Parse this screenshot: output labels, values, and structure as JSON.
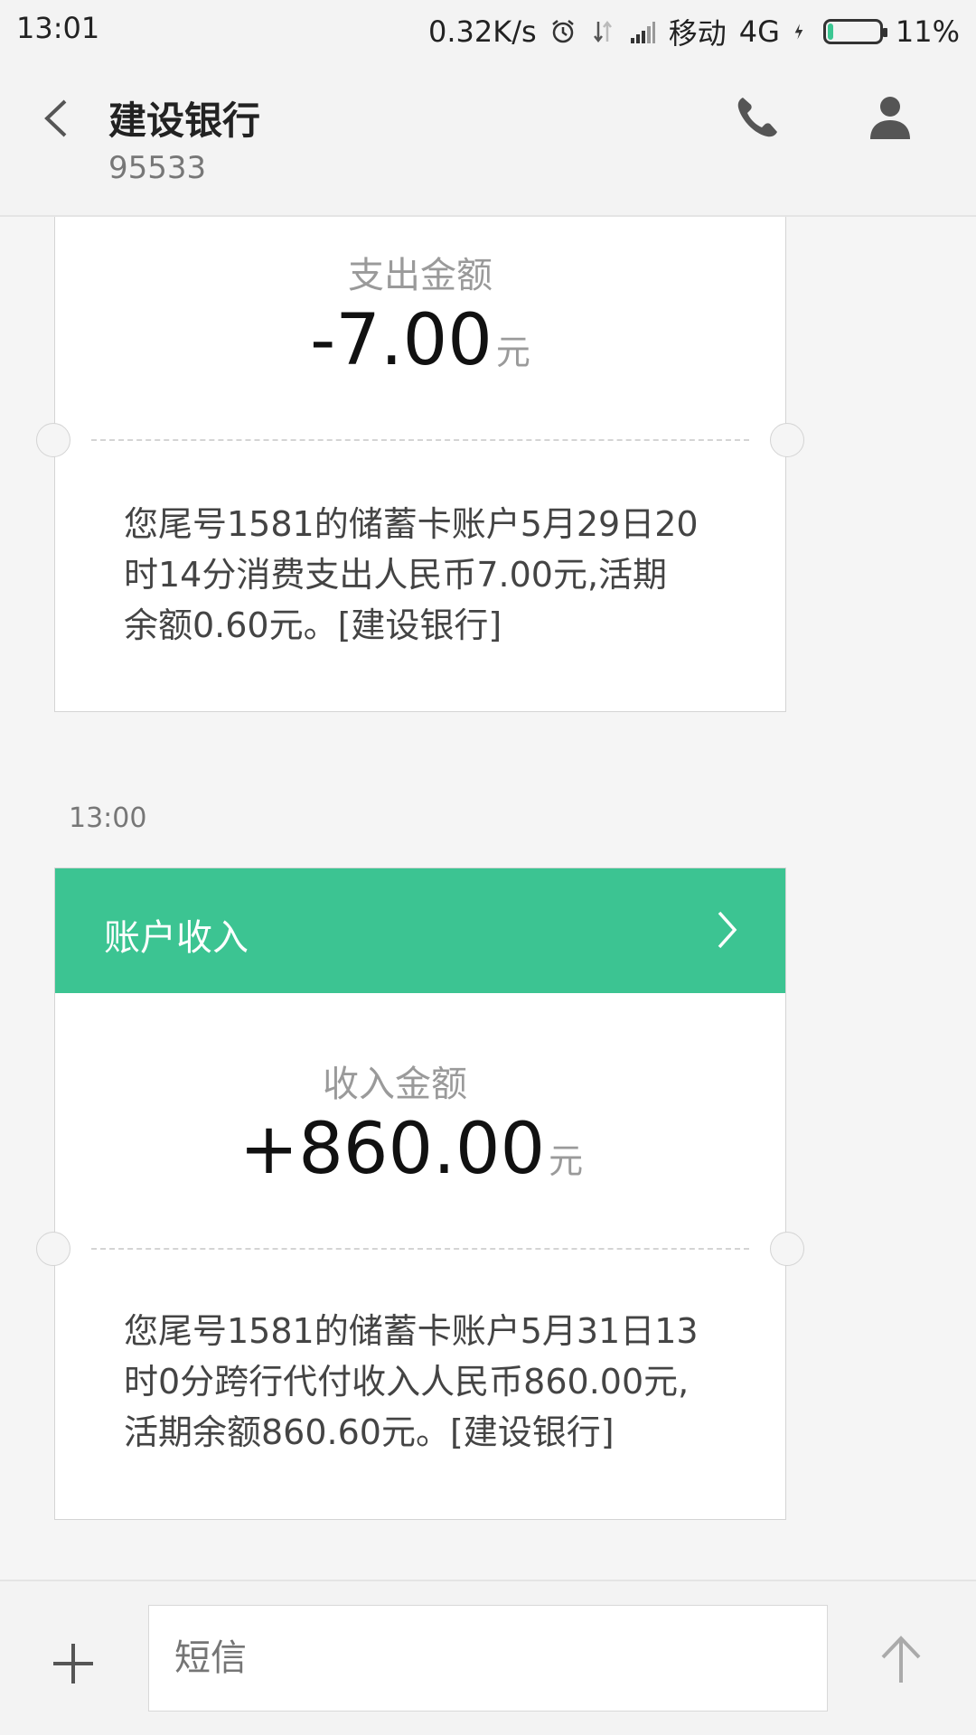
{
  "status_bar": {
    "time": "13:01",
    "speed": "0.32K/s",
    "carrier": "移动",
    "network": "4G",
    "battery_percent": "11%",
    "battery_level": 0.11,
    "icons": [
      "alarm-icon",
      "data-transfer-icon",
      "signal-icon",
      "charging-icon",
      "battery-icon"
    ]
  },
  "header": {
    "title": "建设银行",
    "subtitle": "95533",
    "icons": [
      "back-icon",
      "phone-icon",
      "contact-icon"
    ]
  },
  "messages": [
    {
      "label": "支出金额",
      "amount": "-7.00",
      "unit": "元",
      "body_lines": [
        "您尾号1581的储蓄卡账户5月29日20",
        "时14分消费支出人民币7.00元,活期",
        "余额0.60元。[建设银行]"
      ]
    },
    {
      "timestamp": "13:00",
      "header_title": "账户收入",
      "label": "收入金额",
      "amount": "+860.00",
      "unit": "元",
      "body_lines": [
        "您尾号1581的储蓄卡账户5月31日13",
        "时0分跨行代付收入人民币860.00元,",
        "活期余额860.60元。[建设银行]"
      ]
    }
  ],
  "composer": {
    "placeholder": "短信",
    "icons": [
      "plus-icon",
      "send-icon"
    ]
  },
  "colors": {
    "accent_green": "#3cc492",
    "background": "#f5f5f5"
  }
}
